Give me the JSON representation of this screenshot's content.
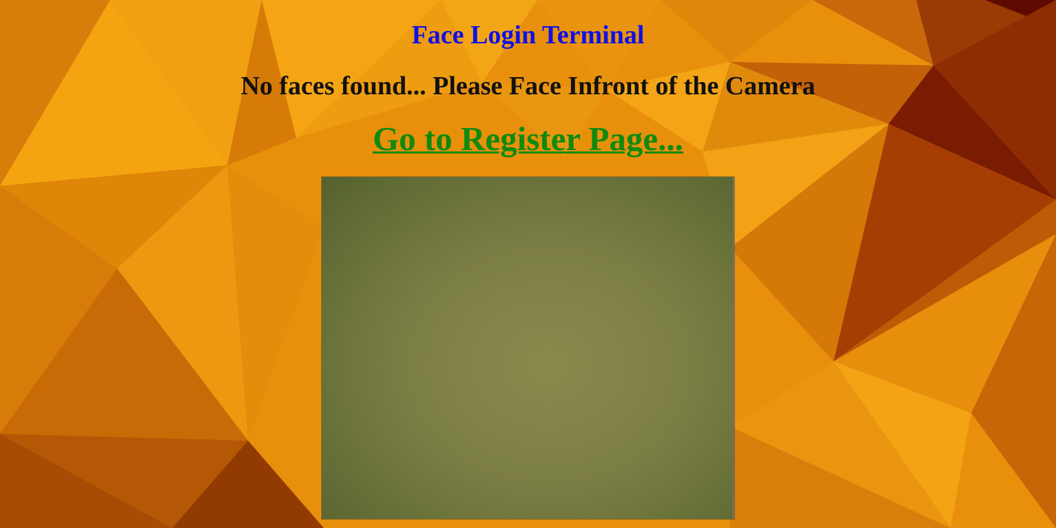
{
  "page": {
    "title": "Face Login Terminal",
    "status_message": "No faces found... Please Face Infront of the Camera",
    "register_link_label": "Go to Register Page..."
  },
  "camera": {
    "feed_state": "no-face-detected",
    "icon": "webcam-feed"
  },
  "colors": {
    "title": "#1010e6",
    "status": "#111111",
    "link": "#0f8a0f",
    "background": "#e8900c"
  }
}
